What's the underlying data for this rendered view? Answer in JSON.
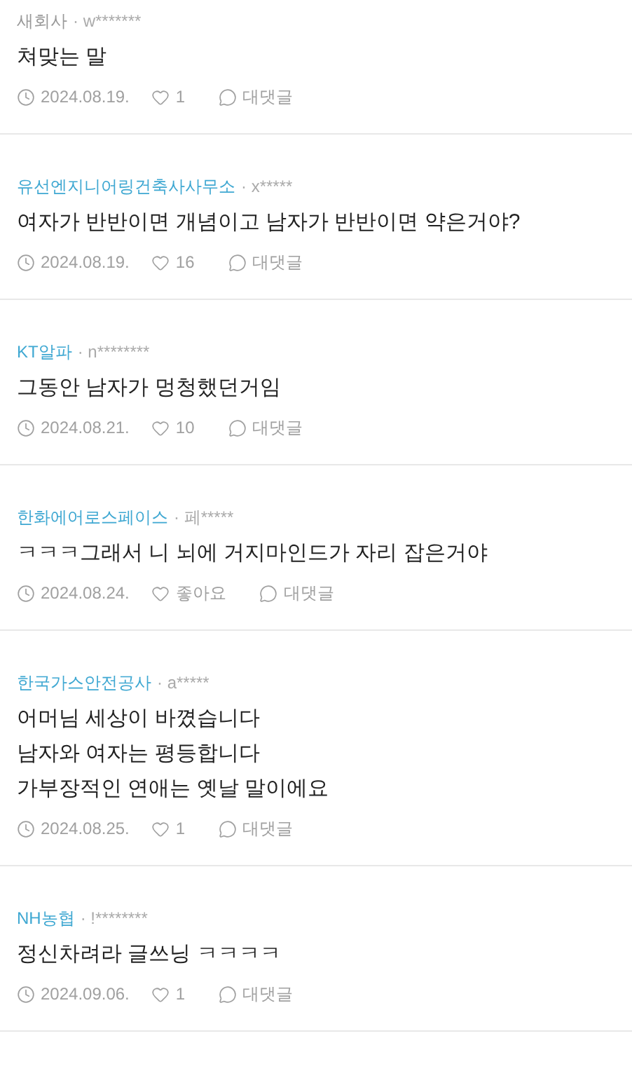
{
  "comments": [
    {
      "company": "새회사",
      "color": "#999999",
      "author": "· w*******",
      "text": "쳐맞는 말",
      "date": "2024.08.19.",
      "likes": "1",
      "reply": "대댓글"
    },
    {
      "company": "유선엔지니어링건축사사무소",
      "color": "#3fa8d2",
      "author": "· x*****",
      "text": "여자가 반반이면 개념이고 남자가 반반이면 약은거야?",
      "date": "2024.08.19.",
      "likes": "16",
      "reply": "대댓글"
    },
    {
      "company": "KT알파",
      "color": "#3fa8d2",
      "author": "· n********",
      "text": "그동안 남자가 멍청했던거임",
      "date": "2024.08.21.",
      "likes": "10",
      "reply": "대댓글"
    },
    {
      "company": "한화에어로스페이스",
      "color": "#3fa8d2",
      "author": "· 페*****",
      "text": "ㅋㅋㅋ그래서 니 뇌에 거지마인드가 자리 잡은거야",
      "date": "2024.08.24.",
      "likes": "좋아요",
      "reply": "대댓글"
    },
    {
      "company": "한국가스안전공사",
      "color": "#3fa8d2",
      "author": "· a*****",
      "text": "어머님 세상이 바꼈습니다\n남자와 여자는 평등합니다\n가부장적인 연애는 옛날 말이에요",
      "date": "2024.08.25.",
      "likes": "1",
      "reply": "대댓글"
    },
    {
      "company": "NH농협",
      "color": "#3fa8d2",
      "author": "· !********",
      "text": "정신차려라 글쓰닝 ㅋㅋㅋㅋ",
      "date": "2024.09.06.",
      "likes": "1",
      "reply": "대댓글"
    }
  ]
}
